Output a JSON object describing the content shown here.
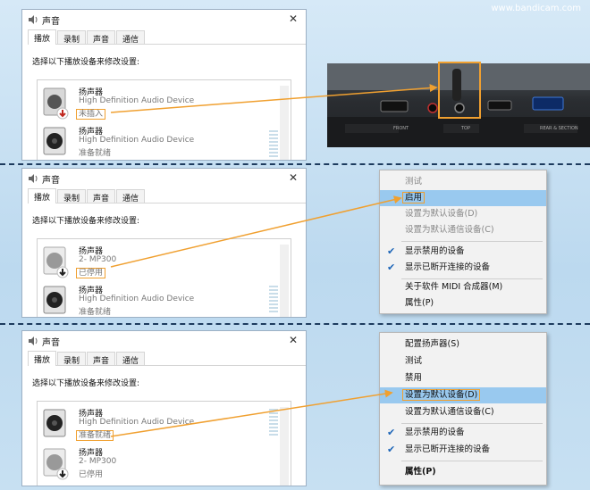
{
  "watermark": "www.bandicam.com",
  "dialog": {
    "title": "声音",
    "close": "✕",
    "tabs": [
      "播放",
      "录制",
      "声音",
      "通信"
    ],
    "instruction": "选择以下播放设备来修改设置:"
  },
  "panel1": {
    "devices": [
      {
        "name": "扬声器",
        "desc": "High Definition Audio Device",
        "status": "未插入"
      },
      {
        "name": "扬声器",
        "desc": "High Definition Audio Device",
        "status": "准备就绪"
      }
    ]
  },
  "panel2": {
    "devices": [
      {
        "name": "扬声器",
        "desc": "2- MP300",
        "status": "已停用"
      },
      {
        "name": "扬声器",
        "desc": "High Definition Audio Device",
        "status": "准备就绪"
      }
    ],
    "menu": [
      "测试",
      "启用",
      "设置为默认设备(D)",
      "设置为默认通信设备(C)",
      "显示禁用的设备",
      "显示已断开连接的设备",
      "关于软件 MIDI 合成器(M)",
      "属性(P)"
    ]
  },
  "panel3": {
    "devices": [
      {
        "name": "扬声器",
        "desc": "High Definition Audio Device",
        "status": "准备就绪"
      },
      {
        "name": "扬声器",
        "desc": "2- MP300",
        "status": "已停用"
      }
    ],
    "menu": [
      "配置扬声器(S)",
      "测试",
      "禁用",
      "设置为默认设备(D)",
      "设置为默认通信设备(C)",
      "显示禁用的设备",
      "显示已断开连接的设备",
      "属性(P)"
    ]
  },
  "photo": {
    "labels": [
      "FRONT",
      "TOP",
      "REAR & SECTION"
    ]
  },
  "colors": {
    "highlight": "#f0a030",
    "menu_selected": "#99c9ef",
    "check": "#1e66b8",
    "separator": "#1d3b5e"
  }
}
